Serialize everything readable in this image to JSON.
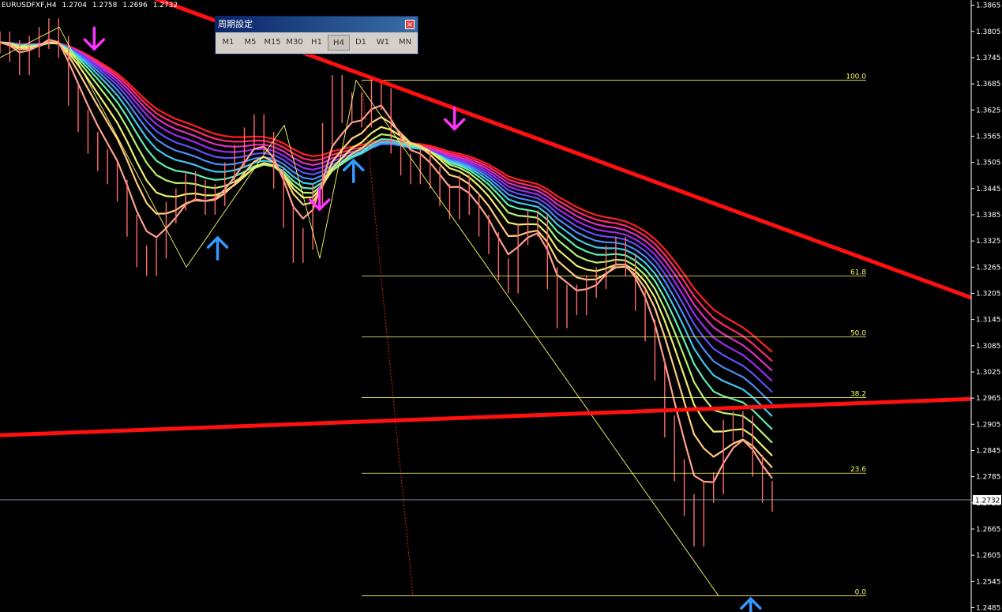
{
  "chart": {
    "symbol": "EURUSDFXF,H4",
    "ohlc": [
      "1.2704",
      "1.2758",
      "1.2696",
      "1.2732"
    ]
  },
  "period_panel": {
    "title": "周期設定",
    "close_icon": "close-icon",
    "buttons": [
      {
        "label": "M1"
      },
      {
        "label": "M5"
      },
      {
        "label": "M15"
      },
      {
        "label": "M30"
      },
      {
        "label": "H1"
      },
      {
        "label": "H4",
        "active": true
      },
      {
        "label": "D1"
      },
      {
        "label": "W1"
      },
      {
        "label": "MN"
      }
    ]
  },
  "chart_data": {
    "type": "line",
    "title": "",
    "xlabel": "",
    "ylabel": "",
    "ylim": [
      1.2475,
      1.3877
    ],
    "y_ticks": [
      "1.3865",
      "1.3805",
      "1.3745",
      "1.3685",
      "1.3625",
      "1.3565",
      "1.3505",
      "1.3445",
      "1.3385",
      "1.3325",
      "1.3265",
      "1.3205",
      "1.3145",
      "1.3085",
      "1.3025",
      "1.2965",
      "1.2905",
      "1.2845",
      "1.2785",
      "1.2725",
      "1.2665",
      "1.2605",
      "1.2545",
      "1.2485"
    ],
    "current_price": "1.2732",
    "price_path": [
      1.378,
      1.376,
      1.373,
      1.377,
      1.379,
      1.381,
      1.377,
      1.366,
      1.36,
      1.355,
      1.351,
      1.348,
      1.344,
      1.336,
      1.329,
      1.327,
      1.331,
      1.339,
      1.342,
      1.346,
      1.344,
      1.341,
      1.343,
      1.348,
      1.352,
      1.356,
      1.359,
      1.355,
      1.347,
      1.338,
      1.33,
      1.333,
      1.343,
      1.357,
      1.368,
      1.362,
      1.364,
      1.361,
      1.367,
      1.365,
      1.355,
      1.35,
      1.348,
      1.351,
      1.347,
      1.343,
      1.34,
      1.345,
      1.341,
      1.336,
      1.332,
      1.326,
      1.323,
      1.334,
      1.337,
      1.336,
      1.324,
      1.315,
      1.32,
      1.318,
      1.322,
      1.324,
      1.329,
      1.331,
      1.327,
      1.319,
      1.312,
      1.303,
      1.29,
      1.28,
      1.272,
      1.265,
      1.275,
      1.277,
      1.289,
      1.291,
      1.29,
      1.281,
      1.275,
      1.273
    ],
    "fibonacci": [
      {
        "level": "100.0",
        "price": 1.3693
      },
      {
        "level": "61.8",
        "price": 1.3245
      },
      {
        "level": "50.0",
        "price": 1.3105
      },
      {
        "level": "38.2",
        "price": 1.2966
      },
      {
        "level": "23.6",
        "price": 1.2793
      },
      {
        "level": "0.0",
        "price": 1.2512
      }
    ],
    "trendlines": [
      {
        "name": "",
        "color": "#ff1010",
        "start": [
          0.16,
          1.388
        ],
        "end": [
          1.0,
          1.3195
        ]
      },
      {
        "name": "",
        "color": "#ff1010",
        "start": [
          0.0,
          1.288
        ],
        "end": [
          1.0,
          1.2963
        ]
      }
    ],
    "signals": [
      {
        "type": "sell",
        "x": 0.097,
        "price": 1.3788
      },
      {
        "type": "buy",
        "x": 0.224,
        "price": 1.3307
      },
      {
        "type": "sell",
        "x": 0.329,
        "price": 1.3421
      },
      {
        "type": "buy",
        "x": 0.364,
        "price": 1.3484
      },
      {
        "type": "sell",
        "x": 0.468,
        "price": 1.3605
      },
      {
        "type": "buy",
        "x": 0.773,
        "price": 1.248
      }
    ],
    "ribbon_colors": [
      "#ff2020",
      "#ff2a70",
      "#dd30c0",
      "#9a2cf0",
      "#6050f5",
      "#4a8cf8",
      "#40c8f0",
      "#60f0b0",
      "#b8f070",
      "#f0f070",
      "#ffcc80",
      "#ffa090"
    ],
    "colors": {
      "background": "#000000",
      "trendline": "#ff1010",
      "fib": "#ffff66",
      "grid": "#ffffff",
      "buy_arrow": "#3399ff",
      "sell_arrow": "#ff33ff",
      "candle": "#ff6b6b",
      "zigzag": "#ffff66",
      "current_price_line": "#8899aa"
    }
  }
}
